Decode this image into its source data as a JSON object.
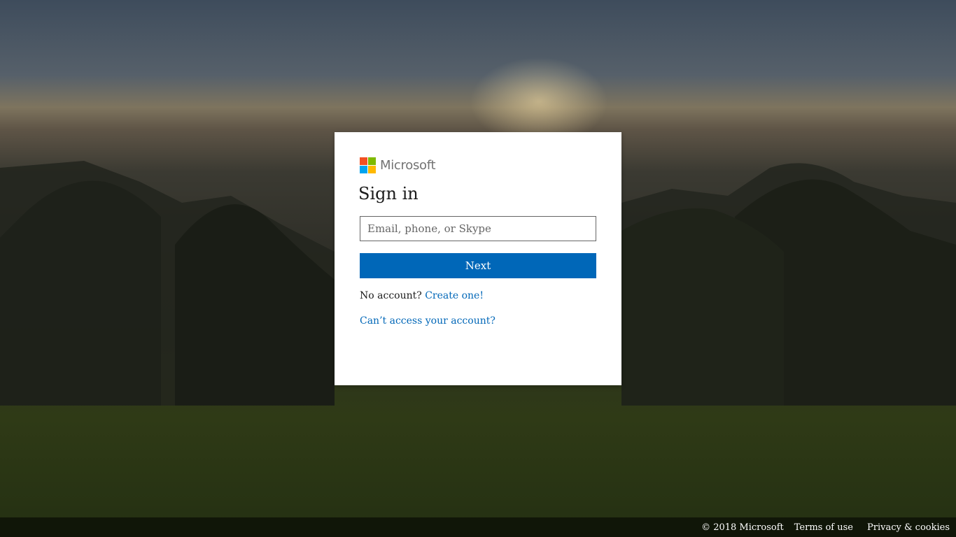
{
  "logo": {
    "text": "Microsoft",
    "colors": [
      "#f25022",
      "#7fba00",
      "#00a4ef",
      "#ffb900"
    ]
  },
  "signin": {
    "title": "Sign in",
    "email_placeholder": "Email, phone, or Skype",
    "email_value": "",
    "next_label": "Next",
    "no_account_text": "No account?",
    "create_link": "Create one!",
    "cant_access_link": "Can’t access your account?"
  },
  "footer": {
    "copyright": "© 2018 Microsoft",
    "terms": "Terms of use",
    "privacy": "Privacy & cookies"
  },
  "colors": {
    "accent": "#0067b8",
    "text": "#1b1b1b",
    "card_bg": "#ffffff"
  }
}
